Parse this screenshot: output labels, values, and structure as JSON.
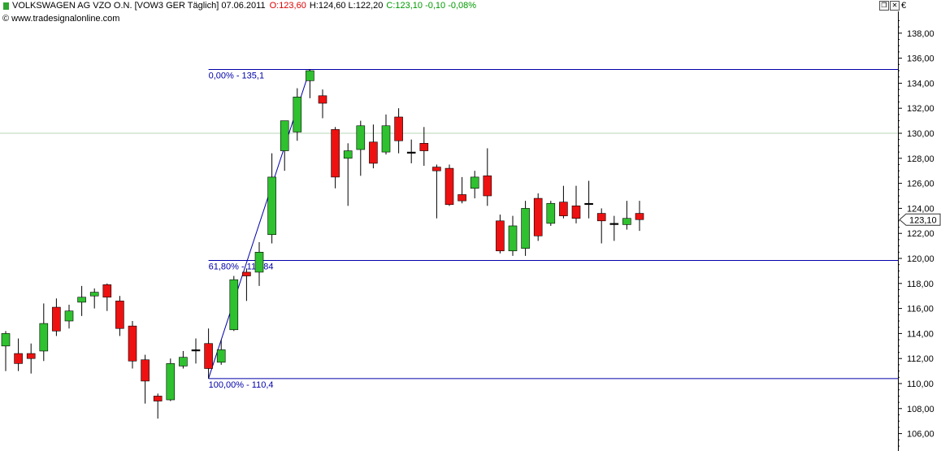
{
  "header": {
    "symbol": "VOLKSWAGEN AG VZO O.N. [VOW3 GER  Täglich] 07.06.2011",
    "open": "O:123,60",
    "hl": "H:124,60 L:122,20",
    "close_change": "C:123,10 -0,10 -0,08%",
    "copyright": "© www.tradesignalonline.com",
    "currency": "€"
  },
  "window_controls": [
    "restore-icon",
    "close-icon"
  ],
  "colors": {
    "up": "#2fc12f",
    "down": "#ee1111",
    "open_text": "#dd0000",
    "close_text": "#009900",
    "fib_line": "#0000aa",
    "grid": "#b7d7b7",
    "price_box": "#333333"
  },
  "chart_data": {
    "type": "candlestick",
    "symbol": "VOW3",
    "ylim": [
      105,
      140
    ],
    "y_ticks": [
      106,
      108,
      110,
      112,
      114,
      116,
      118,
      120,
      122,
      124,
      126,
      128,
      130,
      132,
      134,
      136,
      138
    ],
    "y_tick_labels": [
      "106,00",
      "108,00",
      "110,00",
      "112,00",
      "114,00",
      "116,00",
      "118,00",
      "120,00",
      "122,00",
      "124,00",
      "126,00",
      "128,00",
      "130,00",
      "132,00",
      "134,00",
      "136,00",
      "138,00"
    ],
    "grid_y": [
      100,
      130
    ],
    "last_price": 123.1,
    "last_price_label": "123,10",
    "candles": [
      {
        "o": 113.0,
        "h": 114.2,
        "l": 111.0,
        "c": 114.0
      },
      {
        "o": 112.4,
        "h": 113.6,
        "l": 111.0,
        "c": 111.6
      },
      {
        "o": 112.4,
        "h": 113.2,
        "l": 110.8,
        "c": 112.0
      },
      {
        "o": 112.6,
        "h": 116.4,
        "l": 111.8,
        "c": 114.8
      },
      {
        "o": 116.1,
        "h": 116.8,
        "l": 113.8,
        "c": 114.2
      },
      {
        "o": 115.0,
        "h": 116.3,
        "l": 114.4,
        "c": 115.8
      },
      {
        "o": 116.5,
        "h": 117.8,
        "l": 115.4,
        "c": 116.9
      },
      {
        "o": 117.0,
        "h": 117.6,
        "l": 116.0,
        "c": 117.3
      },
      {
        "o": 117.9,
        "h": 118.0,
        "l": 115.8,
        "c": 116.9
      },
      {
        "o": 116.6,
        "h": 117.0,
        "l": 113.8,
        "c": 114.4
      },
      {
        "o": 114.6,
        "h": 115.0,
        "l": 111.2,
        "c": 111.8
      },
      {
        "o": 111.9,
        "h": 112.3,
        "l": 108.4,
        "c": 110.2
      },
      {
        "o": 109.0,
        "h": 109.2,
        "l": 107.2,
        "c": 108.6
      },
      {
        "o": 108.7,
        "h": 112.0,
        "l": 108.6,
        "c": 111.6
      },
      {
        "o": 111.4,
        "h": 112.6,
        "l": 111.2,
        "c": 112.1
      },
      {
        "o": 112.7,
        "h": 113.6,
        "l": 111.6,
        "c": 112.7
      },
      {
        "o": 113.2,
        "h": 114.4,
        "l": 110.4,
        "c": 111.2
      },
      {
        "o": 111.7,
        "h": 113.5,
        "l": 111.5,
        "c": 112.7
      },
      {
        "o": 114.3,
        "h": 118.6,
        "l": 114.2,
        "c": 118.3
      },
      {
        "o": 118.9,
        "h": 119.2,
        "l": 116.6,
        "c": 118.6
      },
      {
        "o": 118.9,
        "h": 121.3,
        "l": 117.8,
        "c": 120.5
      },
      {
        "o": 121.9,
        "h": 128.4,
        "l": 121.2,
        "c": 126.5
      },
      {
        "o": 128.6,
        "h": 131.0,
        "l": 127.0,
        "c": 131.0
      },
      {
        "o": 130.1,
        "h": 133.6,
        "l": 129.4,
        "c": 132.9
      },
      {
        "o": 134.2,
        "h": 135.1,
        "l": 132.8,
        "c": 135.0
      },
      {
        "o": 133.0,
        "h": 133.5,
        "l": 131.2,
        "c": 132.4
      },
      {
        "o": 130.3,
        "h": 130.5,
        "l": 125.6,
        "c": 126.5
      },
      {
        "o": 128.0,
        "h": 129.2,
        "l": 124.2,
        "c": 128.6
      },
      {
        "o": 128.7,
        "h": 131.0,
        "l": 126.6,
        "c": 130.6
      },
      {
        "o": 129.3,
        "h": 130.7,
        "l": 127.2,
        "c": 127.6
      },
      {
        "o": 128.5,
        "h": 131.5,
        "l": 128.3,
        "c": 130.6
      },
      {
        "o": 131.3,
        "h": 132.0,
        "l": 128.4,
        "c": 129.4
      },
      {
        "o": 128.5,
        "h": 129.5,
        "l": 127.6,
        "c": 128.5
      },
      {
        "o": 129.2,
        "h": 130.5,
        "l": 127.4,
        "c": 128.6
      },
      {
        "o": 127.3,
        "h": 127.5,
        "l": 123.2,
        "c": 127.0
      },
      {
        "o": 127.2,
        "h": 127.5,
        "l": 124.2,
        "c": 124.3
      },
      {
        "o": 125.1,
        "h": 126.5,
        "l": 124.4,
        "c": 124.6
      },
      {
        "o": 125.6,
        "h": 127.0,
        "l": 124.8,
        "c": 126.5
      },
      {
        "o": 126.6,
        "h": 128.8,
        "l": 124.2,
        "c": 125.0
      },
      {
        "o": 123.0,
        "h": 123.5,
        "l": 120.4,
        "c": 120.6
      },
      {
        "o": 120.6,
        "h": 123.4,
        "l": 120.2,
        "c": 122.6
      },
      {
        "o": 120.8,
        "h": 124.6,
        "l": 120.2,
        "c": 124.0
      },
      {
        "o": 124.8,
        "h": 125.2,
        "l": 121.4,
        "c": 121.8
      },
      {
        "o": 122.8,
        "h": 124.6,
        "l": 122.6,
        "c": 124.4
      },
      {
        "o": 124.5,
        "h": 125.8,
        "l": 123.2,
        "c": 123.4
      },
      {
        "o": 124.2,
        "h": 125.8,
        "l": 122.8,
        "c": 123.2
      },
      {
        "o": 124.3,
        "h": 126.2,
        "l": 123.2,
        "c": 124.4
      },
      {
        "o": 123.6,
        "h": 124.0,
        "l": 121.2,
        "c": 123.0
      },
      {
        "o": 122.8,
        "h": 123.4,
        "l": 121.4,
        "c": 122.7
      },
      {
        "o": 122.7,
        "h": 124.6,
        "l": 122.3,
        "c": 123.2
      },
      {
        "o": 123.6,
        "h": 124.6,
        "l": 122.2,
        "c": 123.1
      }
    ],
    "fibonacci": {
      "start_index": 16,
      "end_index": 24,
      "levels": [
        {
          "label": "0,00% - 135,1",
          "value": 135.1
        },
        {
          "label": "61,80% - 119,84",
          "value": 119.84
        },
        {
          "label": "100,00% - 110,4",
          "value": 110.4
        }
      ]
    }
  }
}
